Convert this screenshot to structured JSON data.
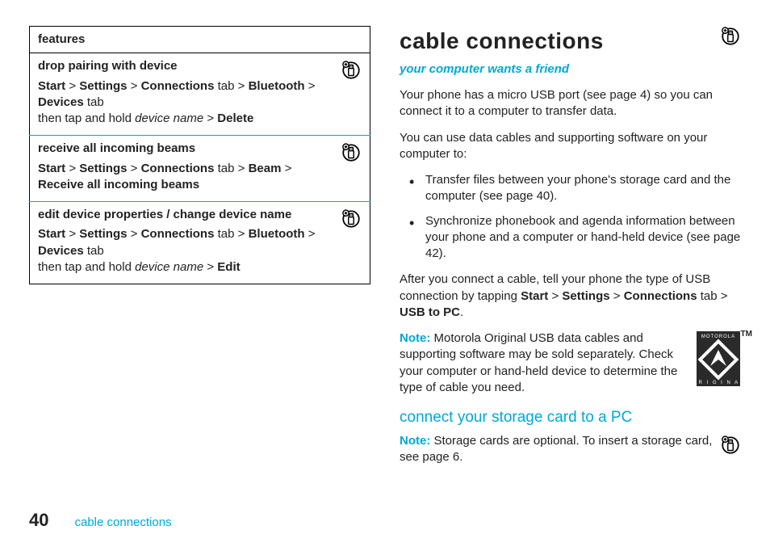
{
  "table": {
    "header": "features",
    "rows": [
      {
        "title": "drop pairing with device",
        "path": [
          {
            "t": "Start",
            "s": "cb"
          },
          {
            "t": " > ",
            "s": ""
          },
          {
            "t": "Settings",
            "s": "cb"
          },
          {
            "t": " > ",
            "s": ""
          },
          {
            "t": "Connections",
            "s": "cb"
          },
          {
            "t": " tab > ",
            "s": ""
          },
          {
            "t": "Bluetooth",
            "s": "cb"
          },
          {
            "t": " > ",
            "s": ""
          },
          {
            "t": "Devices",
            "s": "cb"
          },
          {
            "t": " tab",
            "s": ""
          }
        ],
        "tail": [
          {
            "t": "then tap and hold ",
            "s": ""
          },
          {
            "t": "device name",
            "s": "i"
          },
          {
            "t": " > ",
            "s": ""
          },
          {
            "t": "Delete",
            "s": "cb"
          }
        ]
      },
      {
        "title": "receive all incoming beams",
        "path": [
          {
            "t": "Start",
            "s": "cb"
          },
          {
            "t": " > ",
            "s": ""
          },
          {
            "t": "Settings",
            "s": "cb"
          },
          {
            "t": " > ",
            "s": ""
          },
          {
            "t": "Connections",
            "s": "cb"
          },
          {
            "t": " tab > ",
            "s": ""
          },
          {
            "t": "Beam",
            "s": "cb"
          },
          {
            "t": " > ",
            "s": ""
          },
          {
            "t": "Receive all incoming beams",
            "s": "cb"
          }
        ],
        "tail": []
      },
      {
        "title": "edit device properties / change device name",
        "path": [
          {
            "t": "Start",
            "s": "cb"
          },
          {
            "t": " > ",
            "s": ""
          },
          {
            "t": "Settings",
            "s": "cb"
          },
          {
            "t": " > ",
            "s": ""
          },
          {
            "t": "Connections",
            "s": "cb"
          },
          {
            "t": " tab > ",
            "s": ""
          },
          {
            "t": "Bluetooth",
            "s": "cb"
          },
          {
            "t": " > ",
            "s": ""
          },
          {
            "t": "Devices",
            "s": "cb"
          },
          {
            "t": " tab",
            "s": ""
          }
        ],
        "tail": [
          {
            "t": "then tap and hold ",
            "s": ""
          },
          {
            "t": "device name",
            "s": "i"
          },
          {
            "t": " > ",
            "s": ""
          },
          {
            "t": "Edit",
            "s": "cb"
          }
        ]
      }
    ]
  },
  "right": {
    "heading": "cable connections",
    "tagline": "your computer wants a friend",
    "p1": "Your phone has a micro USB port (see page 4) so you can connect it to a computer to transfer data.",
    "p2": "You can use data cables and supporting software on your computer to:",
    "bullets": [
      "Transfer files between your phone's storage card and the computer (see page 40).",
      "Synchronize phonebook and agenda information between your phone and a computer or hand-held device (see page 42)."
    ],
    "p3": [
      {
        "t": "After you connect a cable, tell your phone the type of USB connection by tapping ",
        "s": ""
      },
      {
        "t": "Start",
        "s": "cb"
      },
      {
        "t": " > ",
        "s": ""
      },
      {
        "t": "Settings",
        "s": "cb"
      },
      {
        "t": " > ",
        "s": ""
      },
      {
        "t": "Connections",
        "s": "cb"
      },
      {
        "t": " tab > ",
        "s": ""
      },
      {
        "t": "USB to PC",
        "s": "cb"
      },
      {
        "t": ".",
        "s": ""
      }
    ],
    "noteLabel": "Note:",
    "note1": " Motorola Original USB data cables and supporting software may be sold separately. Check your computer or hand-held device to determine the type of cable you need.",
    "sub": "connect your storage card to a PC",
    "note2": " Storage cards are optional. To insert a storage card, see page 6.",
    "logo": {
      "top": "MOTOROLA",
      "bottom": "O R I G I N A L",
      "tm": "TM"
    }
  },
  "footer": {
    "page": "40",
    "crumb": "cable connections"
  }
}
